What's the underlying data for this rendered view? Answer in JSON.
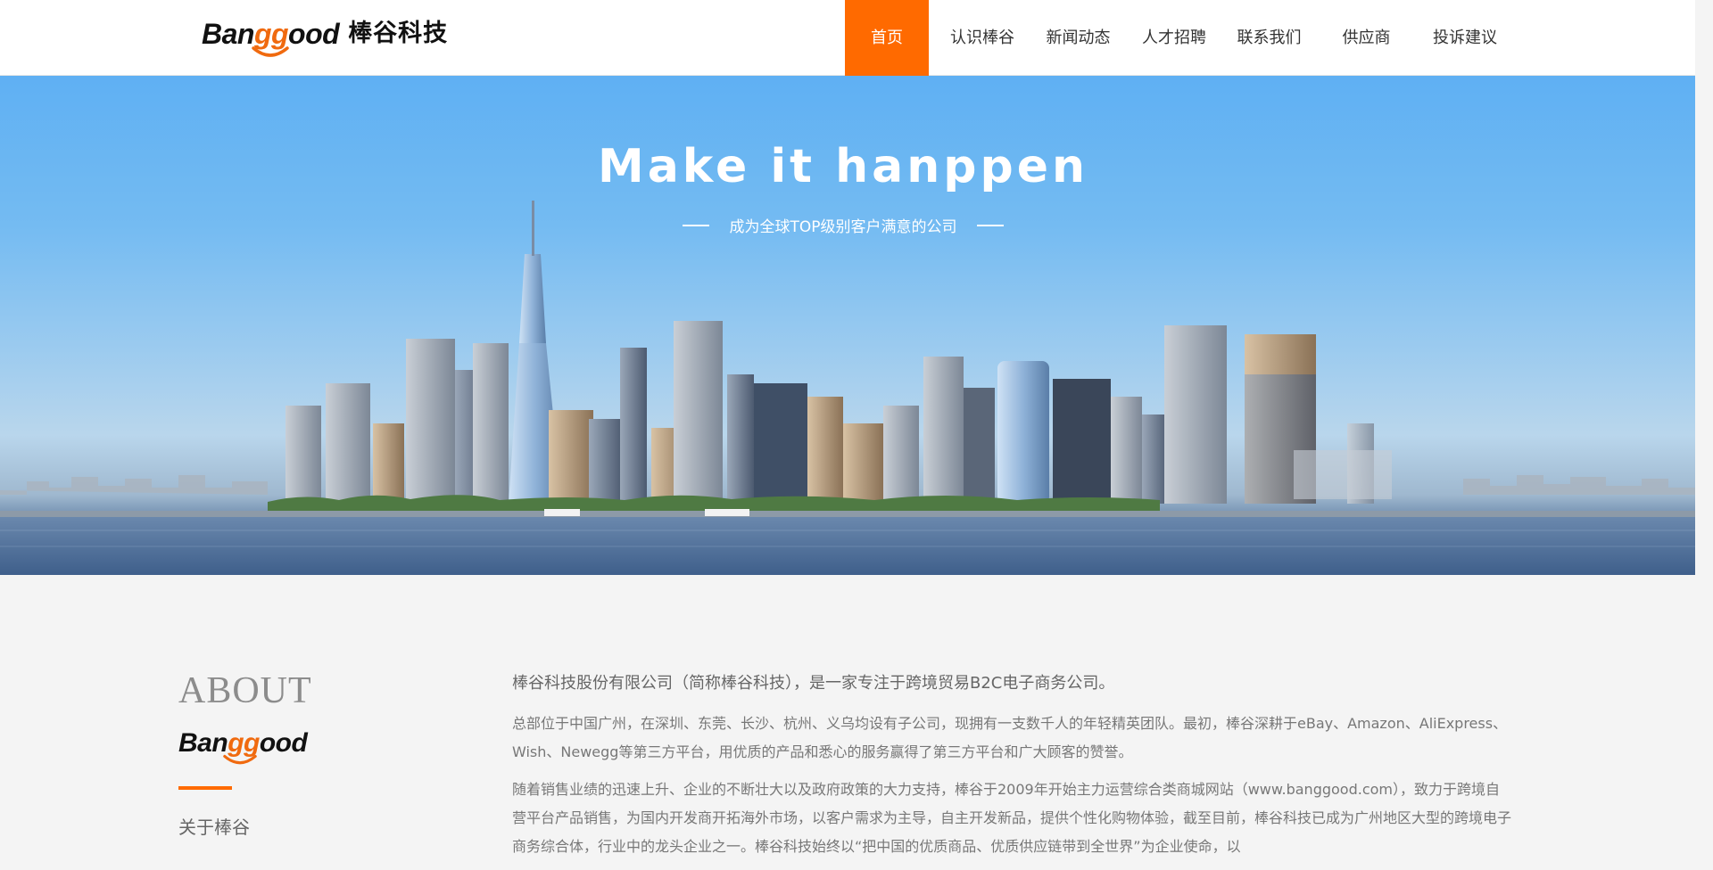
{
  "header": {
    "logo": {
      "brand": "Banggood",
      "cn": "棒谷科技"
    },
    "nav": [
      {
        "label": "首页",
        "active": true
      },
      {
        "label": "认识棒谷",
        "active": false
      },
      {
        "label": "新闻动态",
        "active": false
      },
      {
        "label": "人才招聘",
        "active": false
      },
      {
        "label": "联系我们",
        "active": false
      },
      {
        "label": "供应商",
        "active": false
      },
      {
        "label": "投诉建议",
        "active": false
      }
    ]
  },
  "hero": {
    "title": "Make it hanppen",
    "subtitle": "成为全球TOP级别客户满意的公司"
  },
  "about": {
    "heading": "ABOUT",
    "brand": "Banggood",
    "link": "关于棒谷",
    "lead": "棒谷科技股份有限公司（简称棒谷科技），是一家专注于跨境贸易B2C电子商务公司。",
    "p1": "总部位于中国广州，在深圳、东莞、长沙、杭州、义乌均设有子公司，现拥有一支数千人的年轻精英团队。最初，棒谷深耕于eBay、Amazon、AliExpress、Wish、Newegg等第三方平台，用优质的产品和悉心的服务赢得了第三方平台和广大顾客的赞誉。",
    "p2": "随着销售业绩的迅速上升、企业的不断壮大以及政府政策的大力支持，棒谷于2009年开始主力运营综合类商城网站（www.banggood.com），致力于跨境自营平台产品销售，为国内开发商开拓海外市场，以客户需求为主导，自主开发新品，提供个性化购物体验，截至目前，棒谷科技已成为广州地区大型的跨境电子商务综合体，行业中的龙头企业之一。棒谷科技始终以“把中国的优质商品、优质供应链带到全世界”为企业使命，以"
  },
  "colors": {
    "accent": "#ff6a00",
    "logo_orange": "#f06a0f",
    "sky": "#6ab4f2"
  }
}
